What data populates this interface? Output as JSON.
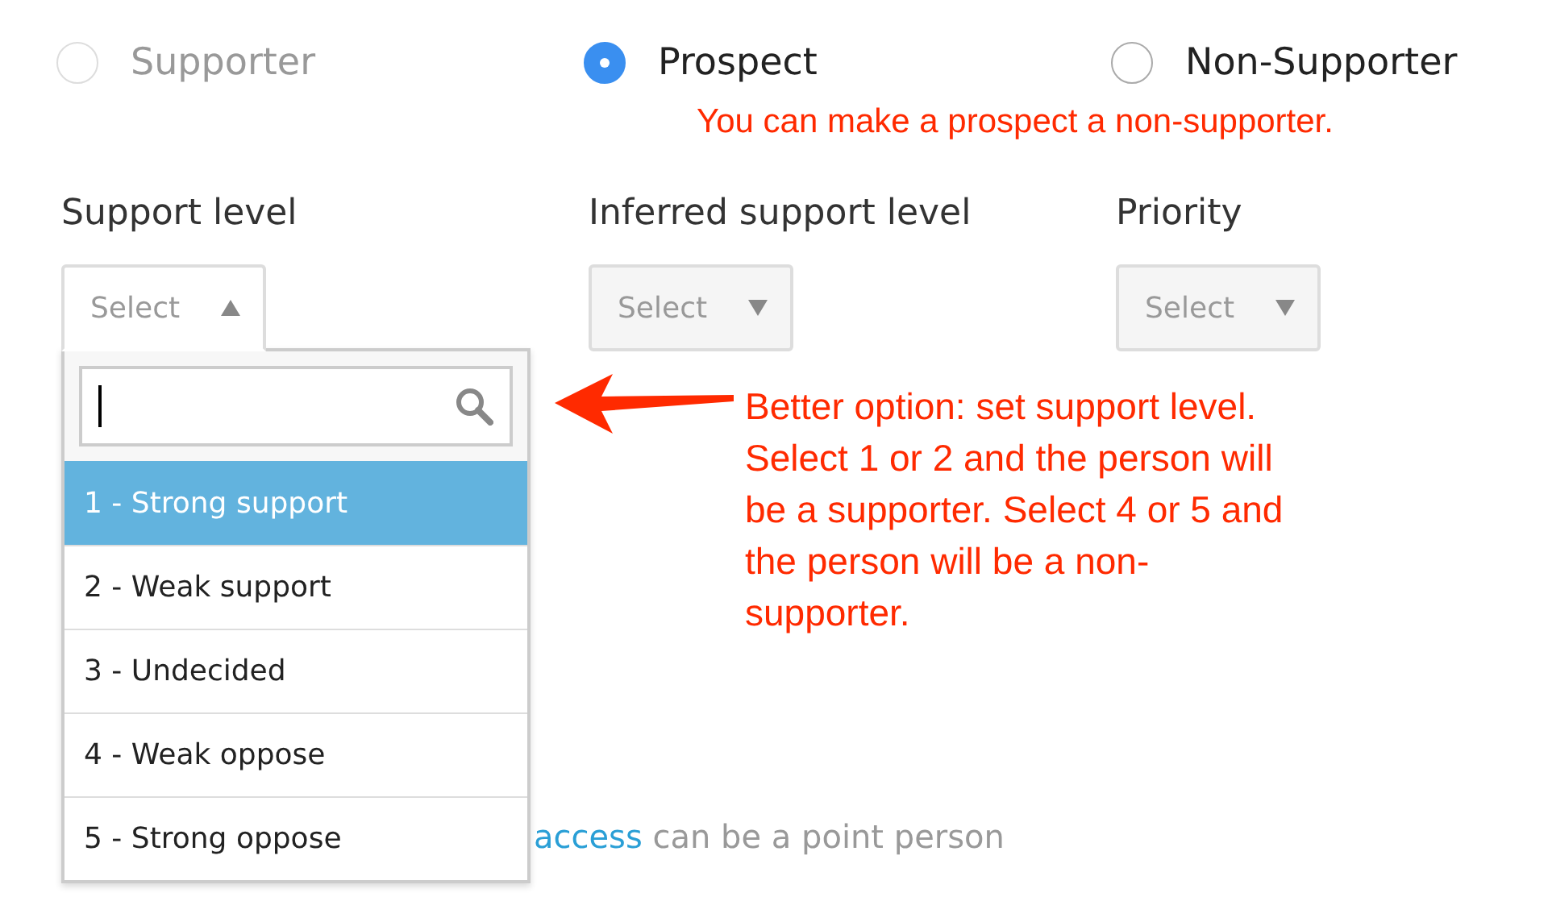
{
  "radios": [
    {
      "label": "Supporter",
      "selected": false,
      "disabled": true
    },
    {
      "label": "Prospect",
      "selected": true,
      "disabled": false
    },
    {
      "label": "Non-Supporter",
      "selected": false,
      "disabled": false
    }
  ],
  "note": "You can make a prospect a non-supporter.",
  "fields": [
    {
      "label": "Support level",
      "value": "Select",
      "expanded": true
    },
    {
      "label": "Inferred support level",
      "value": "Select",
      "expanded": false
    },
    {
      "label": "Priority",
      "value": "Select",
      "expanded": false
    }
  ],
  "dropdown": {
    "options": [
      {
        "label": "1 - Strong support",
        "selected": true
      },
      {
        "label": "2 - Weak support",
        "selected": false
      },
      {
        "label": "3 - Undecided",
        "selected": false
      },
      {
        "label": "4 - Weak oppose",
        "selected": false
      },
      {
        "label": "5 - Strong oppose",
        "selected": false
      }
    ]
  },
  "annotation": "Better option: set support level. Select 1 or 2 and the person will be a supporter. Select 4 or 5 and the person will be a non-supporter.",
  "footer": {
    "link": "access",
    "text": " can be a point person"
  }
}
